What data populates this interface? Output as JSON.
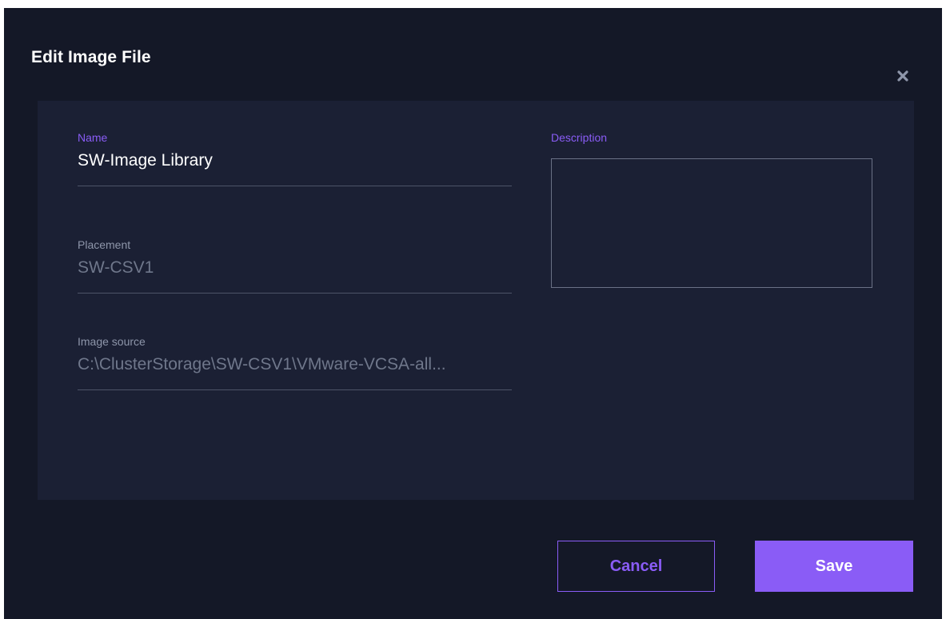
{
  "dialog": {
    "title": "Edit Image File",
    "close_icon": "close-icon"
  },
  "form": {
    "name": {
      "label": "Name",
      "value": "SW-Image Library"
    },
    "placement": {
      "label": "Placement",
      "value": "SW-CSV1"
    },
    "image_source": {
      "label": "Image source",
      "value": "C:\\ClusterStorage\\SW-CSV1\\VMware-VCSA-all..."
    },
    "description": {
      "label": "Description",
      "value": ""
    }
  },
  "buttons": {
    "cancel_label": "Cancel",
    "save_label": "Save"
  },
  "colors": {
    "background": "#141827",
    "panel": "#1b2034",
    "accent": "#8a5cf6",
    "text_primary": "#ffffff",
    "text_muted": "#6f778b"
  }
}
